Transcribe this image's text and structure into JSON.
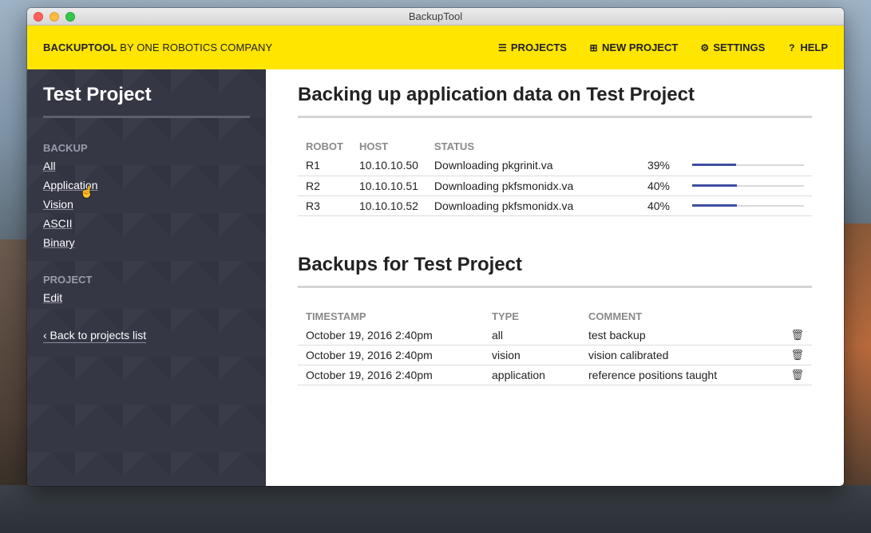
{
  "window": {
    "title": "BackupTool"
  },
  "topbar": {
    "brand_bold": "BACKUPTOOL",
    "brand_rest": " BY ONE ROBOTICS COMPANY",
    "nav": [
      {
        "label": "PROJECTS",
        "icon": "list-icon"
      },
      {
        "label": "NEW PROJECT",
        "icon": "plus-square-icon"
      },
      {
        "label": "SETTINGS",
        "icon": "gear-icon"
      },
      {
        "label": "HELP",
        "icon": "question-circle-icon"
      }
    ]
  },
  "sidebar": {
    "title": "Test Project",
    "backup_heading": "BACKUP",
    "backup_links": [
      "All",
      "Application",
      "Vision",
      "ASCII",
      "Binary"
    ],
    "project_heading": "PROJECT",
    "project_links": [
      "Edit"
    ],
    "back_link": "‹ Back to projects list"
  },
  "progress_section": {
    "title": "Backing up application data on Test Project",
    "columns": [
      "ROBOT",
      "HOST",
      "STATUS"
    ],
    "rows": [
      {
        "robot": "R1",
        "host": "10.10.10.50",
        "status": "Downloading pkgrinit.va",
        "percent_label": "39%",
        "progress": 39
      },
      {
        "robot": "R2",
        "host": "10.10.10.51",
        "status": "Downloading pkfsmonidx.va",
        "percent_label": "40%",
        "progress": 40
      },
      {
        "robot": "R3",
        "host": "10.10.10.52",
        "status": "Downloading pkfsmonidx.va",
        "percent_label": "40%",
        "progress": 40
      }
    ]
  },
  "backups_section": {
    "title": "Backups for Test Project",
    "columns": [
      "TIMESTAMP",
      "TYPE",
      "COMMENT"
    ],
    "rows": [
      {
        "timestamp": "October 19, 2016 2:40pm",
        "type": "all",
        "comment": "test backup"
      },
      {
        "timestamp": "October 19, 2016 2:40pm",
        "type": "vision",
        "comment": "vision calibrated"
      },
      {
        "timestamp": "October 19, 2016 2:40pm",
        "type": "application",
        "comment": "reference positions taught"
      }
    ]
  },
  "colors": {
    "topbar": "#ffe500",
    "sidebar": "#353745",
    "progress_fill": "#3d4fa3"
  }
}
